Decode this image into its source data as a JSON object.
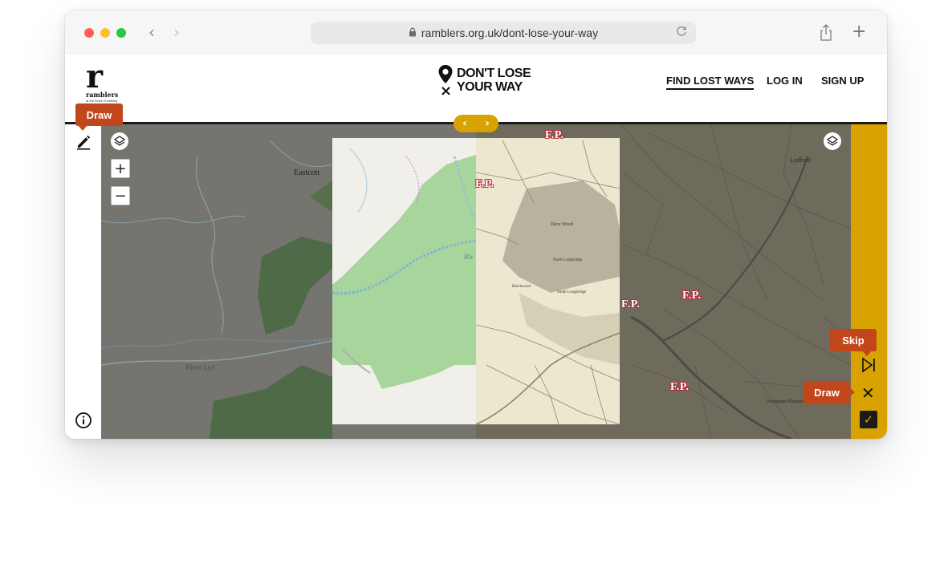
{
  "browser": {
    "url": "ramblers.org.uk/dont-lose-your-way",
    "back_glyph": "‹",
    "forward_glyph": "›",
    "new_tab_glyph": "+"
  },
  "header": {
    "logo_letter": "r",
    "logo_name": "ramblers",
    "logo_tagline": "at the heart of walking",
    "brand_line1": "DON'T LOSE",
    "brand_line2": "YOUR WAY",
    "brand_mark": "×",
    "nav": [
      {
        "label": "FIND LOST WAYS",
        "active": true
      },
      {
        "label": "LOG IN",
        "active": false
      },
      {
        "label": "SIGN UP",
        "active": false
      }
    ]
  },
  "map": {
    "zoom_in": "+",
    "zoom_out": "−",
    "slider_left": "‹",
    "slider_right": "›",
    "place_labels": [
      "Eastcott",
      "River Lyd",
      "Riv",
      "Lydford",
      "Dene Wood",
      "North Longbridge",
      "South Longbridge",
      "Hawkwood",
      "Fountaine Plantation"
    ],
    "fp_labels": [
      "F.P.",
      "F.P.",
      "F.P.",
      "F.P.",
      "F.P."
    ]
  },
  "tools": {
    "draw_tip_top": "Draw",
    "skip_tip": "Skip",
    "draw_tip_bottom": "Draw",
    "close_glyph": "✕",
    "confirm_glyph": "✓"
  },
  "colors": {
    "accent": "#d8a200",
    "tooltip": "#c2461c",
    "fp_red": "#b8263b",
    "osm_green": "#9fd08f",
    "historic_paper": "#ece7cf"
  }
}
